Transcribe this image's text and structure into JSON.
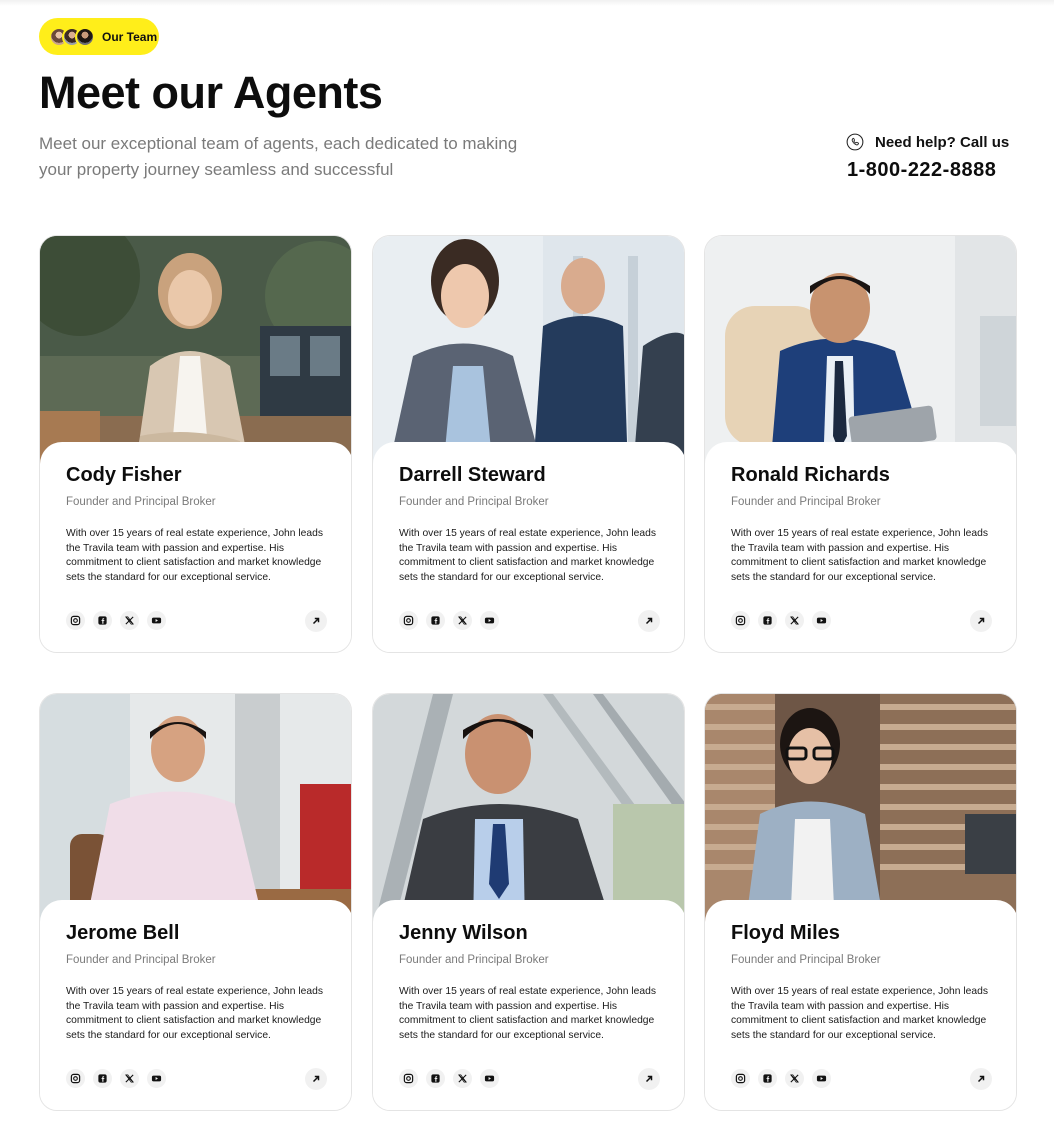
{
  "header": {
    "badge_label": "Our Team",
    "title": "Meet our Agents",
    "subtitle": "Meet our exceptional team of agents, each dedicated to making your property journey seamless and successful",
    "help_label": "Need help? Call us",
    "help_number": "1-800-222-8888"
  },
  "agents": [
    {
      "name": "Cody Fisher",
      "role": "Founder and Principal Broker",
      "description": "With over 15 years of real estate experience, John leads the Travila team with passion and expertise. His commitment to client satisfaction and market knowledge sets the standard for our exceptional service."
    },
    {
      "name": "Darrell Steward",
      "role": "Founder and Principal Broker",
      "description": "With over 15 years of real estate experience, John leads the Travila team with passion and expertise. His commitment to client satisfaction and market knowledge sets the standard for our exceptional service."
    },
    {
      "name": "Ronald Richards",
      "role": "Founder and Principal Broker",
      "description": "With over 15 years of real estate experience, John leads the Travila team with passion and expertise. His commitment to client satisfaction and market knowledge sets the standard for our exceptional service."
    },
    {
      "name": "Jerome Bell",
      "role": "Founder and Principal Broker",
      "description": "With over 15 years of real estate experience, John leads the Travila team with passion and expertise. His commitment to client satisfaction and market knowledge sets the standard for our exceptional service."
    },
    {
      "name": "Jenny Wilson",
      "role": "Founder and Principal Broker",
      "description": "With over 15 years of real estate experience, John leads the Travila team with passion and expertise. His commitment to client satisfaction and market knowledge sets the standard for our exceptional service."
    },
    {
      "name": "Floyd Miles",
      "role": "Founder and Principal Broker",
      "description": "With over 15 years of real estate experience, John leads the Travila team with passion and expertise. His commitment to client satisfaction and market knowledge sets the standard for our exceptional service."
    }
  ],
  "social_icons": [
    "instagram-icon",
    "facebook-icon",
    "x-icon",
    "youtube-icon"
  ],
  "colors": {
    "accent": "#ffee1a",
    "text": "#0d0d0d",
    "muted": "#7a7a7a",
    "icon_bg": "#f1f1f1"
  }
}
